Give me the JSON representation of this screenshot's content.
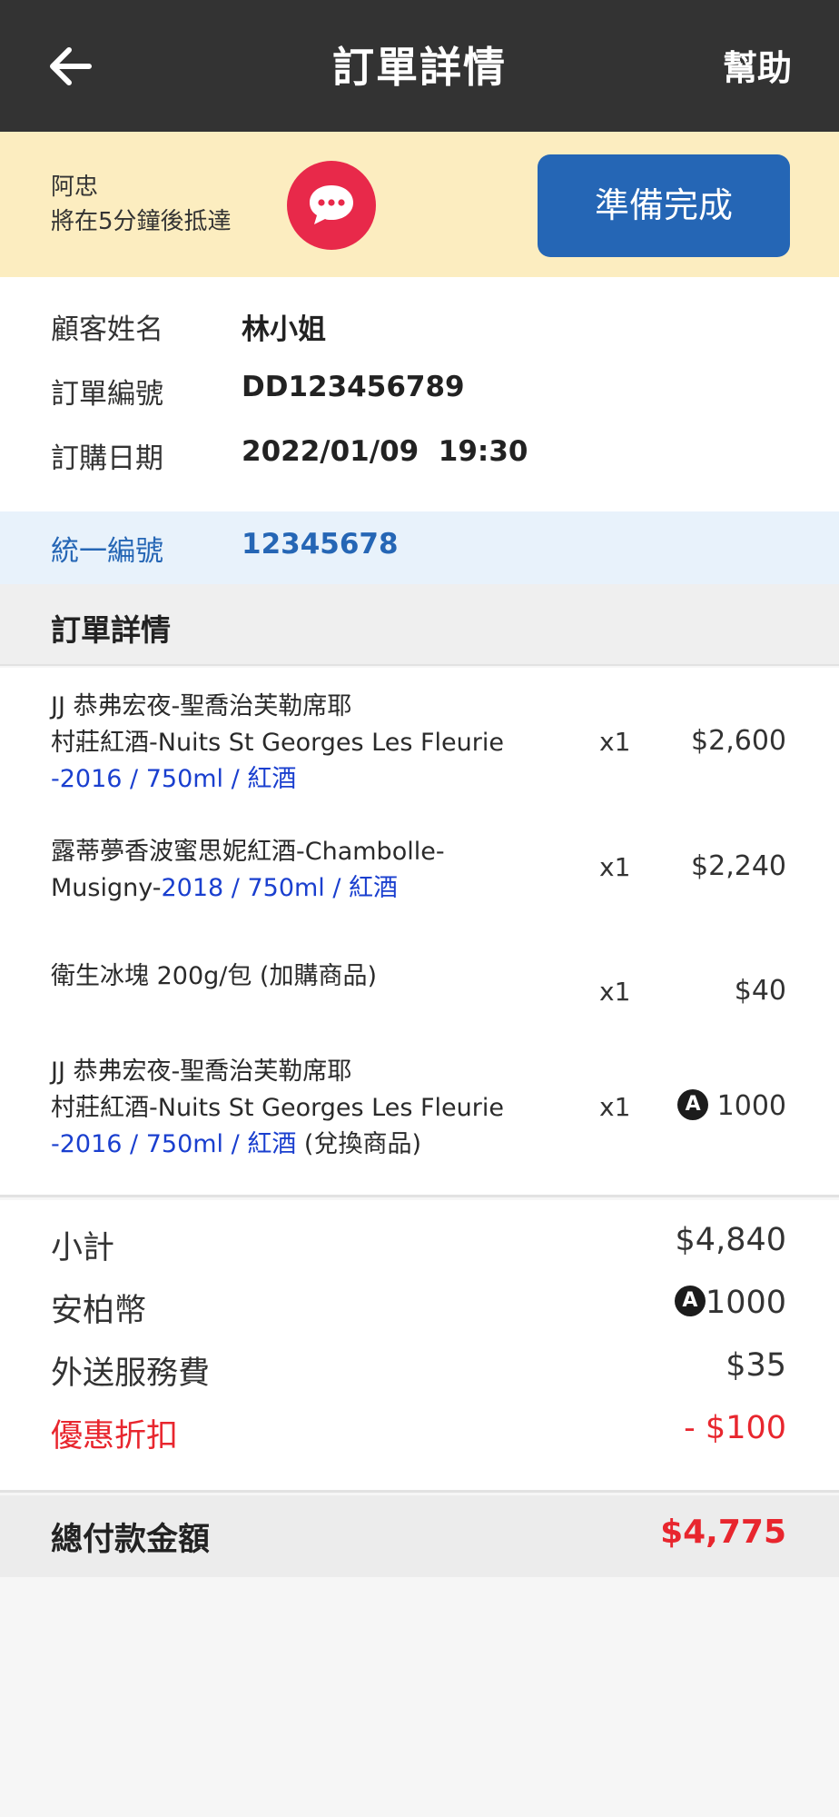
{
  "header": {
    "title": "訂單詳情",
    "help_label": "幫助"
  },
  "rider": {
    "name": "阿忠",
    "eta_text": "將在5分鐘後抵達",
    "ready_button": "準備完成"
  },
  "order_info": {
    "customer_label": "顧客姓名",
    "customer_value": "林小姐",
    "order_no_label": "訂單編號",
    "order_no_value": "DD123456789",
    "date_label": "訂購日期",
    "date_value": "2022/01/09",
    "time_value": "19:30"
  },
  "tax_id": {
    "label": "統一編號",
    "value": "12345678"
  },
  "details_section": {
    "title": "訂單詳情"
  },
  "items": [
    {
      "name_line1": "JJ 恭弗宏夜-聖喬治芙勒席耶",
      "name_line2": "村莊紅酒-Nuits St Georges Les Fleurie",
      "spec_prefix": "-",
      "spec": "2016 / 750ml / 紅酒",
      "suffix": "",
      "qty": "x1",
      "price": "$2,600"
    },
    {
      "name_line1": "露蒂夢香波蜜思妮紅酒-Chambolle-",
      "name_line2": "Musigny-",
      "spec": "2018 / 750ml / 紅酒",
      "qty": "x1",
      "price": "$2,240"
    },
    {
      "name_line1": "衛生冰塊 200g/包 (加購商品)",
      "qty": "x1",
      "price": "$40"
    },
    {
      "name_line1": "JJ 恭弗宏夜-聖喬治芙勒席耶",
      "name_line2": "村莊紅酒-Nuits St Georges Les Fleurie",
      "spec_prefix": "-",
      "spec": "2016 / 750ml / 紅酒",
      "suffix": " (兌換商品)",
      "qty": "x1",
      "coin_symbol": "A",
      "price": "1000"
    }
  ],
  "summary": {
    "subtotal_label": "小計",
    "subtotal_value": "$4,840",
    "coins_label": "安柏幣",
    "coins_symbol": "A",
    "coins_value": "1000",
    "delivery_label": "外送服務費",
    "delivery_value": "$35",
    "discount_label": "優惠折扣",
    "discount_value": "- $100",
    "total_label": "總付款金額",
    "total_value": "$4,775"
  },
  "icons": {
    "back": "arrow-left-icon",
    "chat": "chat-bubble-icon",
    "coin": "amber-coin-icon"
  },
  "colors": {
    "header_bg": "#333333",
    "rider_bg": "#fcedc0",
    "primary": "#2566b5",
    "chat": "#e8294a",
    "discount": "#e8262e",
    "spec_blue": "#1a3fcf"
  }
}
